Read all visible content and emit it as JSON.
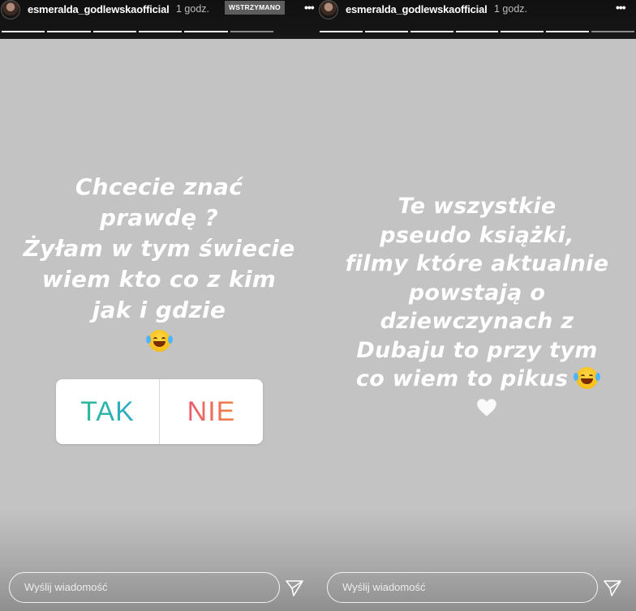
{
  "left_story": {
    "username": "esmeralda_godlewskaofficial",
    "time": "1 godz.",
    "status_badge": "WSTRZYMANO",
    "more_label": "•••",
    "text": "Chcecie znać\nprawdę ?\nŻyłam w tym świecie\nwiem kto co z kim\njak i gdzie",
    "emoji_icon": "face-with-tears-of-joy-icon",
    "poll": {
      "yes_label": "TAK",
      "no_label": "NIE",
      "yes_colors": [
        "#2ec27e",
        "#2fa3e0"
      ],
      "no_colors": [
        "#e8428a",
        "#f49a2a"
      ]
    },
    "reply_placeholder": "Wyślij wiadomość",
    "send_icon": "paper-plane-icon",
    "progress_segments": 6,
    "progress_completed": 5
  },
  "right_story": {
    "username": "esmeralda_godlewskaofficial",
    "time": "1 godz.",
    "more_label": "•••",
    "text": "Te wszystkie\npseudo książki,\nfilmy które aktualnie\npowstają o\ndziewczynach z\nDubaju to przy tym\nco wiem to pikus",
    "emoji_icon": "face-with-tears-of-joy-icon",
    "heart_icon": "white-heart-icon",
    "reply_placeholder": "Wyślij wiadomość",
    "send_icon": "paper-plane-icon",
    "progress_segments": 7,
    "progress_completed": 6
  },
  "colors": {
    "story_background": "#c3c3c3",
    "topbar": "#121212",
    "paused_badge": "#5d5d5d"
  }
}
